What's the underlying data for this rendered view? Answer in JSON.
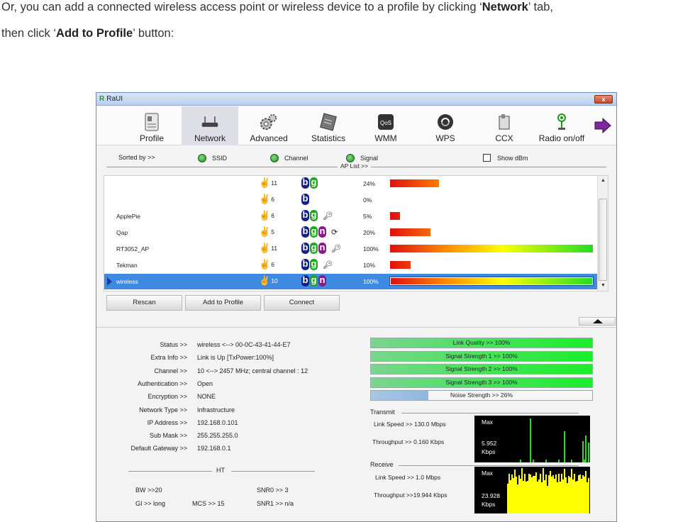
{
  "doc": {
    "line1_prefix": "Or, you can add a connected wireless access point or wireless device to a profile by clicking ‘",
    "line1_bold": "Network",
    "line1_suffix": "’ tab,",
    "line2_prefix": "then click ‘",
    "line2_bold": "Add to Profile",
    "line2_suffix": "’ button:"
  },
  "window": {
    "title": "RaUI",
    "close_label": "x"
  },
  "toolbar": {
    "profile": "Profile",
    "network": "Network",
    "advanced": "Advanced",
    "statistics": "Statistics",
    "wmm": "WMM",
    "wps": "WPS",
    "ccx": "CCX",
    "radio": "Radio on/off",
    "active": "network"
  },
  "sort": {
    "sorted_by": "Sorted by >>",
    "ssid": "SSID",
    "channel": "Channel",
    "signal": "Signal",
    "show_dbm": "Show dBm",
    "ap_list_label": "AP List >>"
  },
  "ap_list": [
    {
      "ssid": "",
      "channel": "11",
      "modes": [
        "b",
        "g"
      ],
      "locked": false,
      "wps": false,
      "signal_pct": 24,
      "signal_text": "24%"
    },
    {
      "ssid": "",
      "channel": "6",
      "modes": [
        "b"
      ],
      "locked": false,
      "wps": false,
      "signal_pct": 0,
      "signal_text": "0%"
    },
    {
      "ssid": "ApplePie",
      "channel": "6",
      "modes": [
        "b",
        "g"
      ],
      "locked": true,
      "wps": false,
      "signal_pct": 5,
      "signal_text": "5%"
    },
    {
      "ssid": "Qap",
      "channel": "5",
      "modes": [
        "b",
        "g",
        "n"
      ],
      "locked": false,
      "wps": true,
      "signal_pct": 20,
      "signal_text": "20%"
    },
    {
      "ssid": "RT3052_AP",
      "channel": "11",
      "modes": [
        "b",
        "g",
        "n"
      ],
      "locked": true,
      "wps": false,
      "signal_pct": 100,
      "signal_text": "100%"
    },
    {
      "ssid": "Tekman",
      "channel": "6",
      "modes": [
        "b",
        "g"
      ],
      "locked": true,
      "wps": false,
      "signal_pct": 10,
      "signal_text": "10%"
    },
    {
      "ssid": "wireless",
      "channel": "10",
      "modes": [
        "b",
        "g",
        "n"
      ],
      "locked": false,
      "wps": false,
      "signal_pct": 100,
      "signal_text": "100%",
      "selected": true
    }
  ],
  "buttons": {
    "rescan": "Rescan",
    "add_to_profile": "Add to Profile",
    "connect": "Connect"
  },
  "info": [
    {
      "key": "Status >>",
      "value": "wireless <--> 00-0C-43-41-44-E7"
    },
    {
      "key": "Extra Info >>",
      "value": "Link is Up [TxPower:100%]"
    },
    {
      "key": "Channel >>",
      "value": "10 <--> 2457 MHz; central channel : 12"
    },
    {
      "key": "Authentication >>",
      "value": "Open"
    },
    {
      "key": "Encryption >>",
      "value": "NONE"
    },
    {
      "key": "Network Type >>",
      "value": "Infrastructure"
    },
    {
      "key": "IP Address >>",
      "value": "192.168.0.101"
    },
    {
      "key": "Sub Mask >>",
      "value": "255.255.255.0"
    },
    {
      "key": "Default Gateway >>",
      "value": "192.168.0.1"
    }
  ],
  "ht": {
    "label": "HT",
    "bw": "BW >>20",
    "gi": "GI >> long",
    "mcs": "MCS >>   15",
    "snr0": "SNR0 >>   3",
    "snr1": "SNR1 >>  n/a"
  },
  "meters": [
    {
      "label": "Link Quality >> 100%",
      "pct": 100,
      "kind": "quality"
    },
    {
      "label": "Signal Strength 1 >> 100%",
      "pct": 100,
      "kind": "quality"
    },
    {
      "label": "Signal Strength 2 >> 100%",
      "pct": 100,
      "kind": "quality"
    },
    {
      "label": "Signal Strength 3 >> 100%",
      "pct": 100,
      "kind": "quality"
    },
    {
      "label": "Noise Strength >> 26%",
      "pct": 26,
      "kind": "noise"
    }
  ],
  "transmit": {
    "title": "Transmit",
    "link_speed": "Link Speed >>   130.0 Mbps",
    "throughput": "Throughput >> 0.160 Kbps",
    "graph_max": "Max",
    "graph_value": "5.952",
    "graph_unit": "Kbps",
    "graph_color": "#22dd22"
  },
  "receive": {
    "title": "Receive",
    "link_speed": "Link Speed >> 1.0 Mbps",
    "throughput": "Throughput >>19.944 Kbps",
    "graph_max": "Max",
    "graph_value": "23.928",
    "graph_unit": "Kbps",
    "graph_color": "#ffff00"
  }
}
